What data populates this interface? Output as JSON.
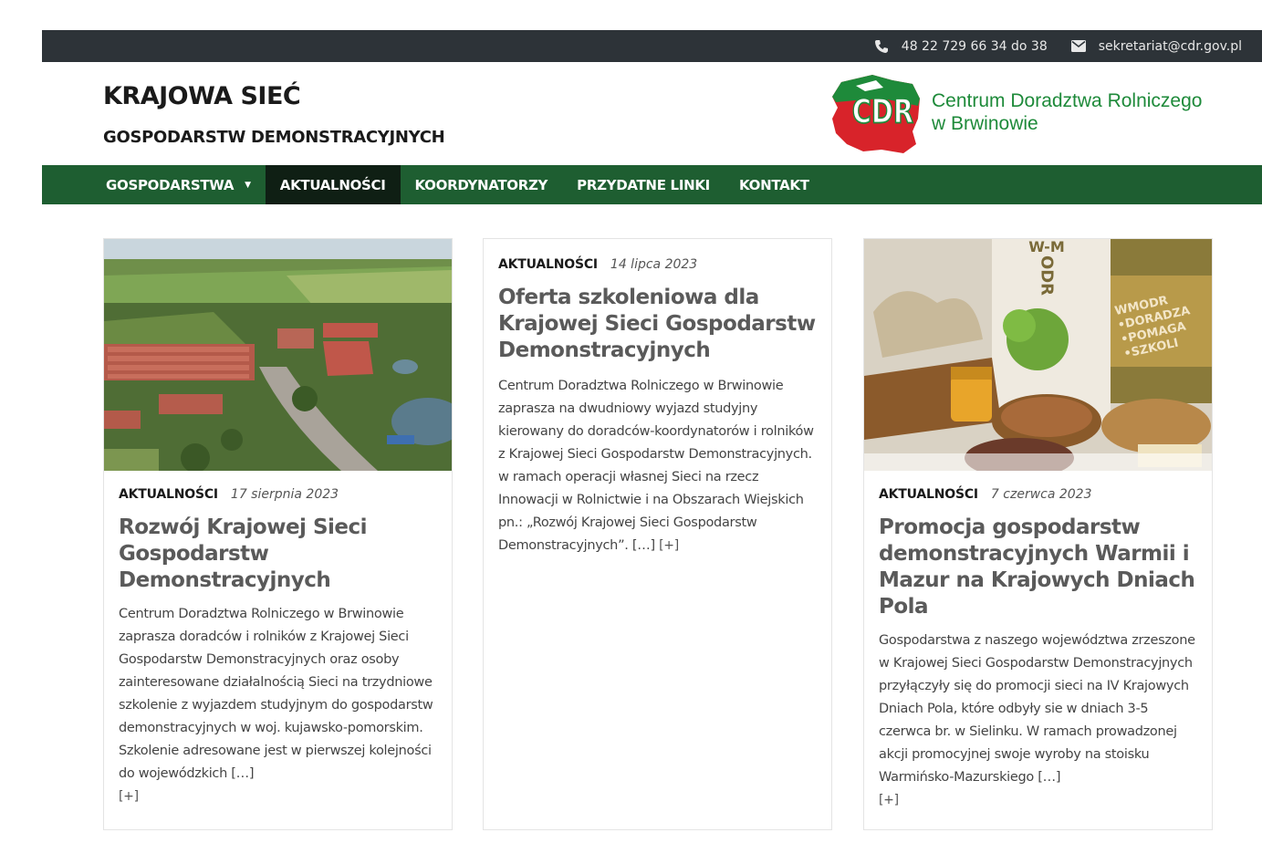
{
  "topbar": {
    "phone": "48 22 729 66 34 do 38",
    "email": "sekretariat@cdr.gov.pl",
    "phone_icon": "phone-icon",
    "email_icon": "envelope-icon"
  },
  "header": {
    "title": "KRAJOWA SIEĆ",
    "subtitle": "GOSPODARSTW DEMONSTRACYJNYCH",
    "logo_text": "CDR",
    "org_line1": "Centrum Doradztwa Rolniczego",
    "org_line2": "w Brwinowie"
  },
  "nav": {
    "items": [
      {
        "label": "GOSPODARSTWA"
      },
      {
        "label": "AKTUALNOŚCI"
      },
      {
        "label": "KOORDYNATORZY"
      },
      {
        "label": "PRZYDATNE LINKI"
      },
      {
        "label": "KONTAKT"
      }
    ],
    "active": "AKTUALNOŚCI"
  },
  "posts": [
    {
      "category": "AKTUALNOŚCI",
      "date": "17 sierpnia 2023",
      "title": "Rozwój Krajowej Sieci Gospodarstw Demonstracyjnych",
      "excerpt": " Centrum Doradztwa Rolniczego w Brwinowie zaprasza doradców i rolników z Krajowej Sieci Gospodarstw Demonstracyjnych oraz osoby zainteresowane działalnością Sieci na trzydniowe szkolenie z wyjazdem studyjnym do gospodarstw demonstracyjnych w woj. kujawsko-pomorskim. Szkolenie adresowane jest w pierwszej kolejności do wojewódzkich […]",
      "more": "[+]"
    },
    {
      "category": "AKTUALNOŚCI",
      "date": "14 lipca 2023",
      "title": "Oferta szkoleniowa dla Krajowej Sieci Gospodarstw Demonstracyjnych",
      "excerpt": "Centrum Doradztwa Rolniczego w Brwinowie zaprasza na dwudniowy wyjazd studyjny kierowany do doradców-koordynatorów i rolników z Krajowej Sieci Gospodarstw Demonstracyjnych. w ramach operacji własnej Sieci na rzecz Innowacji w Rolnictwie i na Obszarach Wiejskich  pn.: „Rozwój Krajowej Sieci Gospodarstw Demonstracyjnych”. […]",
      "more": "[+]"
    },
    {
      "category": "AKTUALNOŚCI",
      "date": "7 czerwca 2023",
      "title": "Promocja gospodarstw demonstracyjnych Warmii i Mazur na Krajowych Dniach Pola",
      "excerpt": "Gospodarstwa z naszego województwa zrzeszone w Krajowej Sieci Gospodarstw Demonstracyjnych przyłączyły się do promocji sieci na IV Krajowych Dniach Pola, które odbyły sie w dniach 3-5 czerwca br. w Sielinku. W ramach prowadzonej akcji promocyjnej swoje wyroby na stoisku Warmińsko-Mazurskiego […]",
      "more": "[+]",
      "image_sign": {
        "top": "W-M",
        "vertical": "ODR",
        "banner": "WMODR\n•DORADZA\n•POMAGA\n•SZKOLI"
      }
    }
  ],
  "colors": {
    "topbar": "#2d3338",
    "nav": "#1e5e31",
    "nav_active": "#0f1f14",
    "brand_green": "#1e8a3a",
    "logo_red": "#d8232a"
  }
}
